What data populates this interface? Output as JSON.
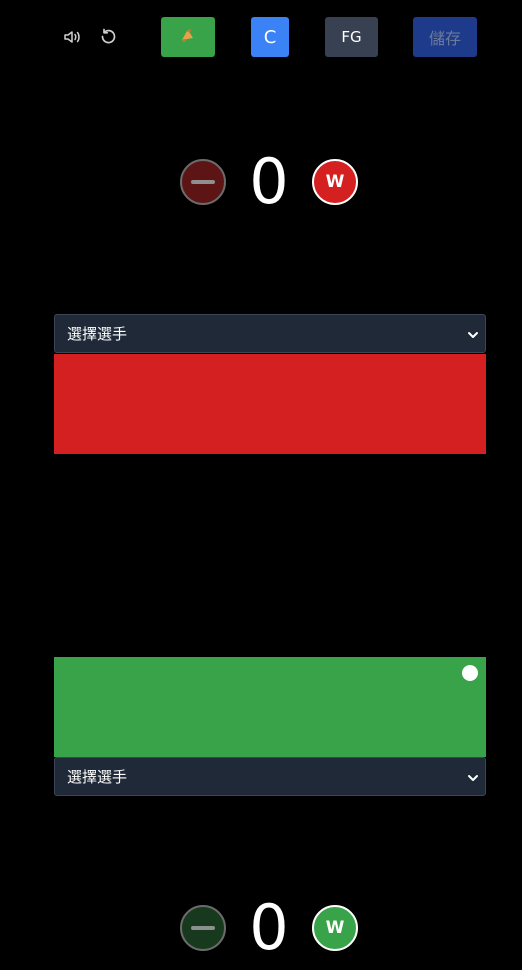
{
  "toolbar": {
    "volume_icon": "volume-icon",
    "reset_icon": "reset-icon",
    "horn_icon": "horn-icon",
    "c_label": "C",
    "fg_label": "FG",
    "save_label": "儲存"
  },
  "colors": {
    "red": "#d42020",
    "green": "#38a348",
    "c_button": "#3b82f6",
    "fg_button": "#374151",
    "save_button": "#1e3a8a",
    "select_bg": "#1f2937"
  },
  "top_team": {
    "score": "0",
    "win_label": "W",
    "player_select": "選擇選手"
  },
  "bottom_team": {
    "score": "0",
    "win_label": "W",
    "player_select": "選擇選手"
  }
}
